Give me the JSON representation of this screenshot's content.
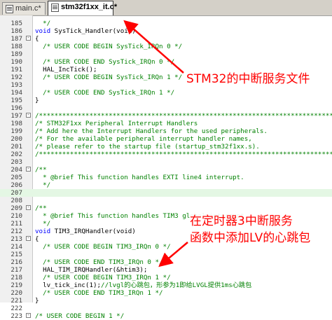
{
  "tabs": [
    {
      "label": "main.c*",
      "active": false
    },
    {
      "label": "stm32f1xx_it.c*",
      "active": true
    }
  ],
  "lines": [
    {
      "num": "185",
      "segs": [
        [
          "c",
          "  */"
        ]
      ]
    },
    {
      "num": "186",
      "segs": [
        [
          "k",
          "void"
        ],
        [
          "t",
          " SysTick_Handler(void)"
        ]
      ]
    },
    {
      "num": "187",
      "fold": "-",
      "segs": [
        [
          "t",
          "{"
        ]
      ]
    },
    {
      "num": "188",
      "segs": [
        [
          "c",
          "  /* USER CODE BEGIN SysTick_IRQn 0 */"
        ]
      ]
    },
    {
      "num": "189",
      "segs": [
        [
          "t",
          ""
        ]
      ]
    },
    {
      "num": "190",
      "segs": [
        [
          "c",
          "  /* USER CODE END SysTick_IRQn 0 */"
        ]
      ]
    },
    {
      "num": "191",
      "segs": [
        [
          "t",
          "  HAL_IncTick();"
        ]
      ]
    },
    {
      "num": "192",
      "segs": [
        [
          "c",
          "  /* USER CODE BEGIN SysTick_IRQn 1 */"
        ]
      ]
    },
    {
      "num": "193",
      "segs": [
        [
          "t",
          ""
        ]
      ]
    },
    {
      "num": "194",
      "segs": [
        [
          "c",
          "  /* USER CODE END SysTick_IRQn 1 */"
        ]
      ]
    },
    {
      "num": "195",
      "segs": [
        [
          "t",
          "}"
        ]
      ]
    },
    {
      "num": "196",
      "segs": [
        [
          "t",
          ""
        ]
      ]
    },
    {
      "num": "197",
      "fold": "-",
      "segs": [
        [
          "c",
          "/******************************************************************************/"
        ]
      ]
    },
    {
      "num": "198",
      "segs": [
        [
          "c",
          "/* STM32F1xx Peripheral Interrupt Handlers                                    */"
        ]
      ]
    },
    {
      "num": "199",
      "segs": [
        [
          "c",
          "/* Add here the Interrupt Handlers for the used peripherals.                  */"
        ]
      ]
    },
    {
      "num": "200",
      "segs": [
        [
          "c",
          "/* For the available peripheral interrupt handler names,                      */"
        ]
      ]
    },
    {
      "num": "201",
      "segs": [
        [
          "c",
          "/* please refer to the startup file (startup_stm32f1xx.s).                    */"
        ]
      ]
    },
    {
      "num": "202",
      "segs": [
        [
          "c",
          "/******************************************************************************/"
        ]
      ]
    },
    {
      "num": "203",
      "segs": [
        [
          "t",
          ""
        ]
      ]
    },
    {
      "num": "204",
      "fold": "-",
      "segs": [
        [
          "c",
          "/**"
        ]
      ]
    },
    {
      "num": "205",
      "segs": [
        [
          "c",
          "  * @brief This function handles EXTI line4 interrupt."
        ]
      ]
    },
    {
      "num": "206",
      "segs": [
        [
          "c",
          "  */"
        ]
      ]
    },
    {
      "num": "207",
      "hl": true,
      "segs": [
        [
          "t",
          ""
        ]
      ]
    },
    {
      "num": "208",
      "segs": [
        [
          "t",
          ""
        ]
      ]
    },
    {
      "num": "209",
      "fold": "-",
      "segs": [
        [
          "c",
          "/**"
        ]
      ]
    },
    {
      "num": "210",
      "segs": [
        [
          "c",
          "  * @brief This function handles TIM3 global interrupt."
        ]
      ]
    },
    {
      "num": "211",
      "segs": [
        [
          "c",
          "  */"
        ]
      ]
    },
    {
      "num": "212",
      "segs": [
        [
          "k",
          "void"
        ],
        [
          "t",
          " TIM3_IRQHandler(void)"
        ]
      ]
    },
    {
      "num": "213",
      "fold": "-",
      "segs": [
        [
          "t",
          "{"
        ]
      ]
    },
    {
      "num": "214",
      "segs": [
        [
          "c",
          "  /* USER CODE BEGIN TIM3_IRQn 0 */"
        ]
      ]
    },
    {
      "num": "215",
      "segs": [
        [
          "t",
          ""
        ]
      ]
    },
    {
      "num": "216",
      "segs": [
        [
          "c",
          "  /* USER CODE END TIM3_IRQn 0 */"
        ]
      ]
    },
    {
      "num": "217",
      "segs": [
        [
          "t",
          "  HAL_TIM_IRQHandler(&htim3);"
        ]
      ]
    },
    {
      "num": "218",
      "segs": [
        [
          "c",
          "  /* USER CODE BEGIN TIM3_IRQn 1 */"
        ]
      ]
    },
    {
      "num": "219",
      "segs": [
        [
          "t",
          "  lv_tick_inc(1);"
        ],
        [
          "c",
          "//lvgl的心跳包，形参为1即给LVGL提供1ms心跳包"
        ]
      ]
    },
    {
      "num": "220",
      "segs": [
        [
          "c",
          "  /* USER CODE END TIM3_IRQn 1 */"
        ]
      ]
    },
    {
      "num": "221",
      "segs": [
        [
          "t",
          "}"
        ]
      ]
    },
    {
      "num": "222",
      "segs": [
        [
          "t",
          ""
        ]
      ]
    },
    {
      "num": "223",
      "fold": "-",
      "segs": [
        [
          "c",
          "/* USER CODE BEGIN 1 */"
        ]
      ]
    }
  ],
  "annotations": {
    "note1": "STM32的中断服务文件",
    "note2_line1": "在定时器3中断服务",
    "note2_line2": "函数中添加LV的心跳包"
  },
  "colors": {
    "keyword": "#0000ff",
    "comment": "#008000",
    "annotation": "#ff0000",
    "highlight_line": "#e4f7e4"
  }
}
